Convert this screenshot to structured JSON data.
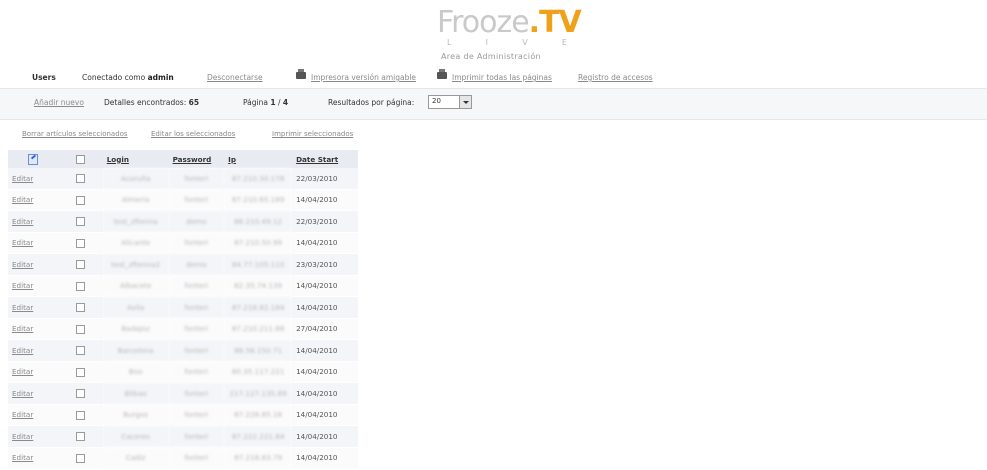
{
  "logo": {
    "brand_left": "Frooze",
    "brand_right": ".TV",
    "live_letters": [
      "L",
      "I",
      "V",
      "E"
    ],
    "subtitle": "Area de Administración"
  },
  "topbar": {
    "section": "Users",
    "connected_prefix": "Conectado como",
    "username": "admin",
    "logout": "Desconectarse",
    "print_friendly": "Impresora versión amigable",
    "print_all": "Imprimir todas las páginas",
    "access_log": "Registro de accesos"
  },
  "infobar": {
    "add_new": "Añadir nuevo",
    "details_label": "Detalles encontrados:",
    "details_count": "65",
    "page_label": "Página",
    "page_current": "1",
    "page_sep": "/",
    "page_total": "4",
    "results_label": "Resultados por página:",
    "results_value": "20"
  },
  "actions": {
    "delete_selected": "Borrar artículos seleccionados",
    "edit_selected": "Editar los seleccionados",
    "print_selected": "Imprimir seleccionados"
  },
  "table": {
    "columns": [
      "Login",
      "Password",
      "Ip",
      "Date Start"
    ],
    "edit_label": "Editar",
    "rows": [
      {
        "login": "Acoruña",
        "password": "fonteri",
        "ip": "87.210.30.178",
        "date": "22/03/2010"
      },
      {
        "login": "Almeria",
        "password": "fonteri",
        "ip": "87.210.65.189",
        "date": "14/04/2010"
      },
      {
        "login": "test_zftenna",
        "password": "demo",
        "ip": "88.210.49.12",
        "date": "22/03/2010"
      },
      {
        "login": "Alicante",
        "password": "fonteri",
        "ip": "87.210.50.99",
        "date": "14/04/2010"
      },
      {
        "login": "test_zftenna2",
        "password": "demo",
        "ip": "84.77.105.110",
        "date": "23/03/2010"
      },
      {
        "login": "Albacete",
        "password": "fonteri",
        "ip": "62.35.74.139",
        "date": "14/04/2010"
      },
      {
        "login": "Avila",
        "password": "fonteri",
        "ip": "87.218.82.184",
        "date": "14/04/2010"
      },
      {
        "login": "Badajoz",
        "password": "fonteri",
        "ip": "87.210.211.88",
        "date": "27/04/2010"
      },
      {
        "login": "Barcelona",
        "password": "fonteri",
        "ip": "88.56.150.71",
        "date": "14/04/2010"
      },
      {
        "login": "Boo",
        "password": "fonteri",
        "ip": "80.35.117.221",
        "date": "14/04/2010"
      },
      {
        "login": "Bilbao",
        "password": "fonteri",
        "ip": "217.127.135.89",
        "date": "14/04/2010"
      },
      {
        "login": "Burgos",
        "password": "fonteri",
        "ip": "87.228.85.18",
        "date": "14/04/2010"
      },
      {
        "login": "Caceres",
        "password": "fonteri",
        "ip": "87.222.221.84",
        "date": "14/04/2010"
      },
      {
        "login": "Cadiz",
        "password": "fonteri",
        "ip": "87.218.83.79",
        "date": "14/04/2010"
      }
    ]
  }
}
